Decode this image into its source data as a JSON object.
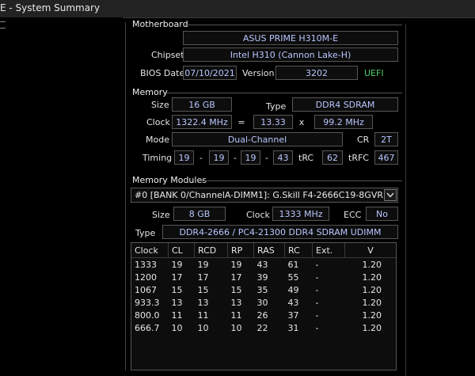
{
  "window": {
    "title": "E - System Summary"
  },
  "motherboard": {
    "section_title": "Motherboard",
    "model": "ASUS PRIME H310M-E",
    "chipset_label": "Chipset",
    "chipset": "Intel H310 (Cannon Lake-H)",
    "bios_date_label": "BIOS Date",
    "bios_date": "07/10/2021",
    "version_label": "Version",
    "version": "3202",
    "uefi": "UEFI"
  },
  "memory": {
    "section_title": "Memory",
    "size_label": "Size",
    "size": "16 GB",
    "type_label": "Type",
    "type": "DDR4 SDRAM",
    "clock_label": "Clock",
    "clock": "1322.4 MHz",
    "eq": "=",
    "multiplier": "13.33",
    "times": "x",
    "bclk": "99.2 MHz",
    "mode_label": "Mode",
    "mode": "Dual-Channel",
    "cr_label": "CR",
    "cr": "2T",
    "timing_label": "Timing",
    "t1": "19",
    "t2": "19",
    "t3": "19",
    "t4": "43",
    "dash": "-",
    "trc_label": "tRC",
    "trc": "62",
    "trfc_label": "tRFC",
    "trfc": "467"
  },
  "modules": {
    "section_title": "Memory Modules",
    "selected": "#0 [BANK 0/ChannelA-DIMM1]: G.Skill F4-2666C19-8GVR",
    "size_label": "Size",
    "size": "8 GB",
    "clock_label": "Clock",
    "clock": "1333 MHz",
    "ecc_label": "ECC",
    "ecc": "No",
    "type_label": "Type",
    "type": "DDR4-2666 / PC4-21300 DDR4 SDRAM UDIMM",
    "table": {
      "headers": [
        "Clock",
        "CL",
        "RCD",
        "RP",
        "RAS",
        "RC",
        "Ext.",
        "V"
      ],
      "rows": [
        [
          "1333",
          "19",
          "19",
          "19",
          "43",
          "61",
          "-",
          "1.20"
        ],
        [
          "1200",
          "17",
          "17",
          "17",
          "39",
          "55",
          "-",
          "1.20"
        ],
        [
          "1067",
          "15",
          "15",
          "15",
          "35",
          "49",
          "-",
          "1.20"
        ],
        [
          "933.3",
          "13",
          "13",
          "13",
          "30",
          "43",
          "-",
          "1.20"
        ],
        [
          "800.0",
          "11",
          "11",
          "11",
          "26",
          "37",
          "-",
          "1.20"
        ],
        [
          "666.7",
          "10",
          "10",
          "10",
          "22",
          "31",
          "-",
          "1.20"
        ]
      ]
    }
  }
}
